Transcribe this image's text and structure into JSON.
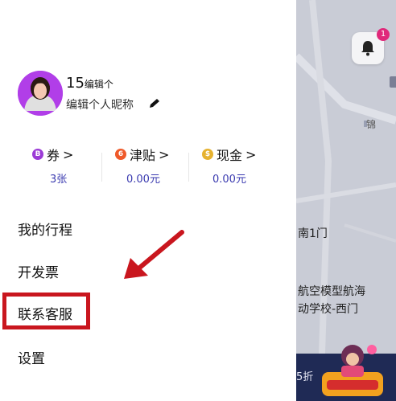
{
  "map": {
    "labels": [
      {
        "text": "锦",
        "key": "jin"
      },
      {
        "text": "南1门",
        "key": "gate"
      },
      {
        "text": "航空模型航海",
        "key": "school1"
      },
      {
        "text": "动学校-西门",
        "key": "school2"
      }
    ],
    "notification_count": "1",
    "banner_discount": "5折"
  },
  "profile": {
    "name": "15",
    "name_suffix": "编辑个",
    "edit_nickname": "编辑个人昵称"
  },
  "wallet": {
    "coupon": {
      "label": "券",
      "value": "3张",
      "icon_char": "B",
      "color": "#9b3bd6"
    },
    "allowance": {
      "label": "津贴",
      "value": "0.00元",
      "icon_char": "6",
      "color": "#ef5a2a"
    },
    "cash": {
      "label": "现金",
      "value": "0.00元",
      "icon_char": "$",
      "color": "#e6b230"
    },
    "chevron": ">"
  },
  "menu": {
    "trips": "我的行程",
    "invoice": "开发票",
    "support": "联系客服",
    "settings": "设置"
  }
}
